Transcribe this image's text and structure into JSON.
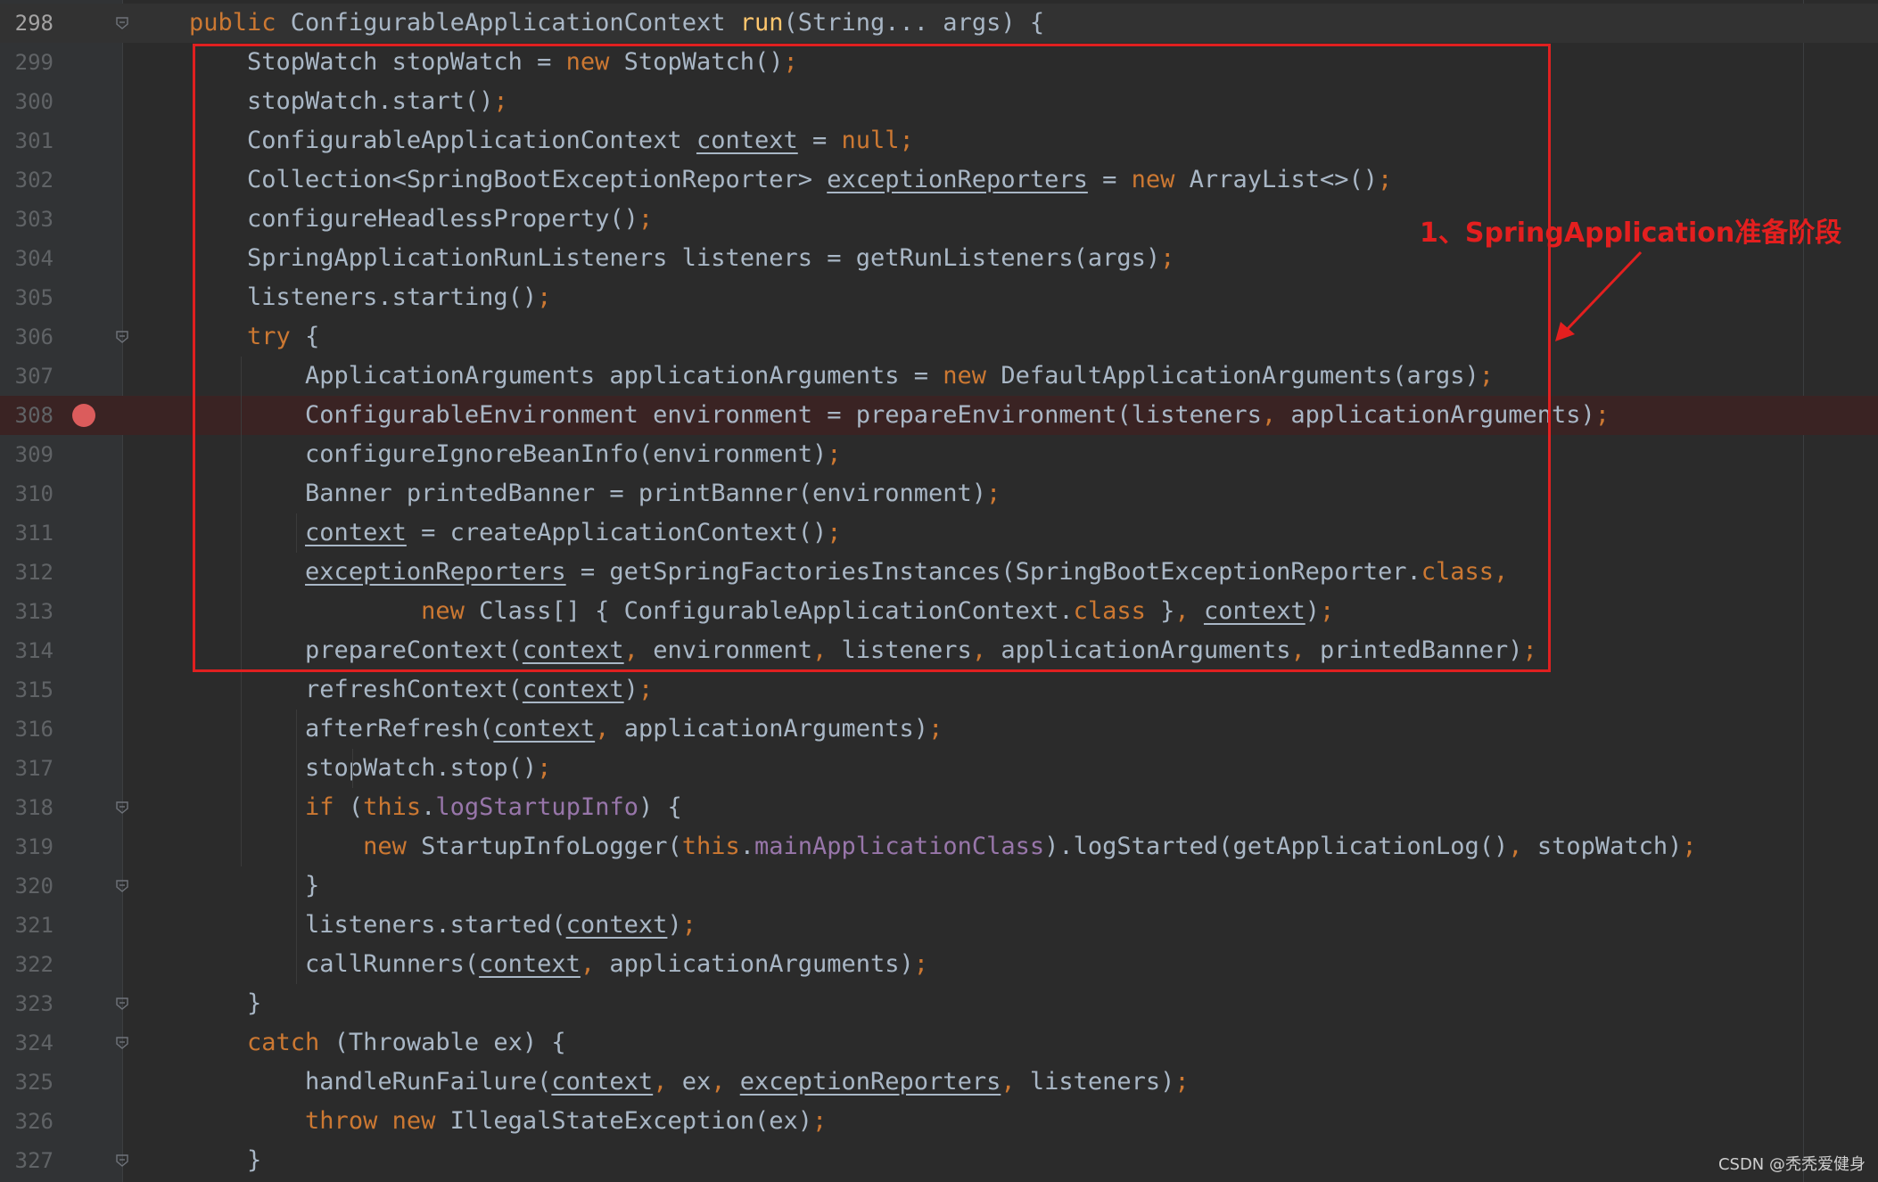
{
  "editor": {
    "lines": [
      {
        "num": "298",
        "tokens": [
          [
            "kw",
            "public "
          ],
          [
            "t",
            "ConfigurableApplicationContext "
          ],
          [
            "fn",
            "run"
          ],
          [
            "t",
            "(String... args) {"
          ]
        ]
      },
      {
        "num": "299",
        "tokens": [
          [
            "t",
            "    StopWatch stopWatch = "
          ],
          [
            "kw",
            "new "
          ],
          [
            "t",
            "StopWatch()"
          ],
          [
            "kw",
            ";"
          ]
        ]
      },
      {
        "num": "300",
        "tokens": [
          [
            "t",
            "    stopWatch.start()"
          ],
          [
            "kw",
            ";"
          ]
        ]
      },
      {
        "num": "301",
        "tokens": [
          [
            "t",
            "    ConfigurableApplicationContext "
          ],
          [
            "u",
            "context"
          ],
          [
            "t",
            " = "
          ],
          [
            "kw",
            "null;"
          ]
        ]
      },
      {
        "num": "302",
        "tokens": [
          [
            "t",
            "    Collection<SpringBootExceptionReporter> "
          ],
          [
            "u",
            "exceptionReporters"
          ],
          [
            "t",
            " = "
          ],
          [
            "kw",
            "new "
          ],
          [
            "t",
            "ArrayList<>()"
          ],
          [
            "kw",
            ";"
          ]
        ]
      },
      {
        "num": "303",
        "tokens": [
          [
            "t",
            "    configureHeadlessProperty()"
          ],
          [
            "kw",
            ";"
          ]
        ]
      },
      {
        "num": "304",
        "tokens": [
          [
            "t",
            "    SpringApplicationRunListeners listeners = getRunListeners(args)"
          ],
          [
            "kw",
            ";"
          ]
        ]
      },
      {
        "num": "305",
        "tokens": [
          [
            "t",
            "    listeners.starting()"
          ],
          [
            "kw",
            ";"
          ]
        ]
      },
      {
        "num": "306",
        "tokens": [
          [
            "t",
            "    "
          ],
          [
            "kw",
            "try "
          ],
          [
            "t",
            "{"
          ]
        ]
      },
      {
        "num": "307",
        "tokens": [
          [
            "t",
            "        ApplicationArguments applicationArguments = "
          ],
          [
            "kw",
            "new "
          ],
          [
            "t",
            "DefaultApplicationArguments(args)"
          ],
          [
            "kw",
            ";"
          ]
        ]
      },
      {
        "num": "308",
        "tokens": [
          [
            "t",
            "        ConfigurableEnvironment environment = prepareEnvironment(listeners"
          ],
          [
            "kw",
            ", "
          ],
          [
            "t",
            "applicationArguments)"
          ],
          [
            "kw",
            ";"
          ]
        ]
      },
      {
        "num": "309",
        "tokens": [
          [
            "t",
            "        configureIgnoreBeanInfo(environment)"
          ],
          [
            "kw",
            ";"
          ]
        ]
      },
      {
        "num": "310",
        "tokens": [
          [
            "t",
            "        Banner printedBanner = printBanner(environment)"
          ],
          [
            "kw",
            ";"
          ]
        ]
      },
      {
        "num": "311",
        "tokens": [
          [
            "t",
            "        "
          ],
          [
            "u",
            "context"
          ],
          [
            "t",
            " = createApplicationContext()"
          ],
          [
            "kw",
            ";"
          ]
        ]
      },
      {
        "num": "312",
        "tokens": [
          [
            "t",
            "        "
          ],
          [
            "u",
            "exceptionReporters"
          ],
          [
            "t",
            " = getSpringFactoriesInstances(SpringBootExceptionReporter."
          ],
          [
            "kw",
            "class,"
          ]
        ]
      },
      {
        "num": "313",
        "tokens": [
          [
            "t",
            "                "
          ],
          [
            "kw",
            "new "
          ],
          [
            "t",
            "Class[] { ConfigurableApplicationContext."
          ],
          [
            "kw",
            "class "
          ],
          [
            "t",
            "}"
          ],
          [
            "kw",
            ", "
          ],
          [
            "u",
            "context"
          ],
          [
            "t",
            ")"
          ],
          [
            "kw",
            ";"
          ]
        ]
      },
      {
        "num": "314",
        "tokens": [
          [
            "t",
            "        prepareContext("
          ],
          [
            "u",
            "context"
          ],
          [
            "kw",
            ", "
          ],
          [
            "t",
            "environment"
          ],
          [
            "kw",
            ", "
          ],
          [
            "t",
            "listeners"
          ],
          [
            "kw",
            ", "
          ],
          [
            "t",
            "applicationArguments"
          ],
          [
            "kw",
            ", "
          ],
          [
            "t",
            "printedBanner)"
          ],
          [
            "kw",
            ";"
          ]
        ]
      },
      {
        "num": "315",
        "tokens": [
          [
            "t",
            "        refreshContext("
          ],
          [
            "u",
            "context"
          ],
          [
            "t",
            ")"
          ],
          [
            "kw",
            ";"
          ]
        ]
      },
      {
        "num": "316",
        "tokens": [
          [
            "t",
            "        afterRefresh("
          ],
          [
            "u",
            "context"
          ],
          [
            "kw",
            ", "
          ],
          [
            "t",
            "applicationArguments)"
          ],
          [
            "kw",
            ";"
          ]
        ]
      },
      {
        "num": "317",
        "tokens": [
          [
            "t",
            "        stopWatch.stop()"
          ],
          [
            "kw",
            ";"
          ]
        ]
      },
      {
        "num": "318",
        "tokens": [
          [
            "t",
            "        "
          ],
          [
            "kw",
            "if "
          ],
          [
            "t",
            "("
          ],
          [
            "kw",
            "this"
          ],
          [
            "t",
            "."
          ],
          [
            "fld",
            "logStartupInfo"
          ],
          [
            "t",
            ") {"
          ]
        ]
      },
      {
        "num": "319",
        "tokens": [
          [
            "t",
            "            "
          ],
          [
            "kw",
            "new "
          ],
          [
            "t",
            "StartupInfoLogger("
          ],
          [
            "kw",
            "this"
          ],
          [
            "t",
            "."
          ],
          [
            "fld",
            "mainApplicationClass"
          ],
          [
            "t",
            ").logStarted(getApplicationLog()"
          ],
          [
            "kw",
            ", "
          ],
          [
            "t",
            "stopWatch)"
          ],
          [
            "kw",
            ";"
          ]
        ]
      },
      {
        "num": "320",
        "tokens": [
          [
            "t",
            "        }"
          ]
        ]
      },
      {
        "num": "321",
        "tokens": [
          [
            "t",
            "        listeners.started("
          ],
          [
            "u",
            "context"
          ],
          [
            "t",
            ")"
          ],
          [
            "kw",
            ";"
          ]
        ]
      },
      {
        "num": "322",
        "tokens": [
          [
            "t",
            "        callRunners("
          ],
          [
            "u",
            "context"
          ],
          [
            "kw",
            ", "
          ],
          [
            "t",
            "applicationArguments)"
          ],
          [
            "kw",
            ";"
          ]
        ]
      },
      {
        "num": "323",
        "tokens": [
          [
            "t",
            "    }"
          ]
        ]
      },
      {
        "num": "324",
        "tokens": [
          [
            "t",
            "    "
          ],
          [
            "kw",
            "catch "
          ],
          [
            "t",
            "(Throwable ex) {"
          ]
        ]
      },
      {
        "num": "325",
        "tokens": [
          [
            "t",
            "        handleRunFailure("
          ],
          [
            "u",
            "context"
          ],
          [
            "kw",
            ", "
          ],
          [
            "t",
            "ex"
          ],
          [
            "kw",
            ", "
          ],
          [
            "u",
            "exceptionReporters"
          ],
          [
            "kw",
            ", "
          ],
          [
            "t",
            "listeners)"
          ],
          [
            "kw",
            ";"
          ]
        ]
      },
      {
        "num": "326",
        "tokens": [
          [
            "t",
            "        "
          ],
          [
            "kw",
            "throw new "
          ],
          [
            "t",
            "IllegalStateException(ex)"
          ],
          [
            "kw",
            ";"
          ]
        ]
      },
      {
        "num": "327",
        "tokens": [
          [
            "t",
            "    }"
          ]
        ]
      }
    ]
  },
  "annotation": {
    "text": "1、SpringApplication准备阶段"
  },
  "watermark": {
    "text": "CSDN @秃秃爱健身"
  },
  "colors": {
    "background": "#2b2b2b",
    "keyword": "#cc7832",
    "method_declaration": "#ffc66d",
    "field": "#9876aa",
    "default_text": "#a9b7c6",
    "highlight_box": "#e02020",
    "breakpoint": "#db5c5c"
  },
  "icons": {
    "breakpoint_line": "308",
    "fold_markers_at": [
      "298",
      "306",
      "318",
      "320",
      "323",
      "324",
      "327"
    ]
  }
}
